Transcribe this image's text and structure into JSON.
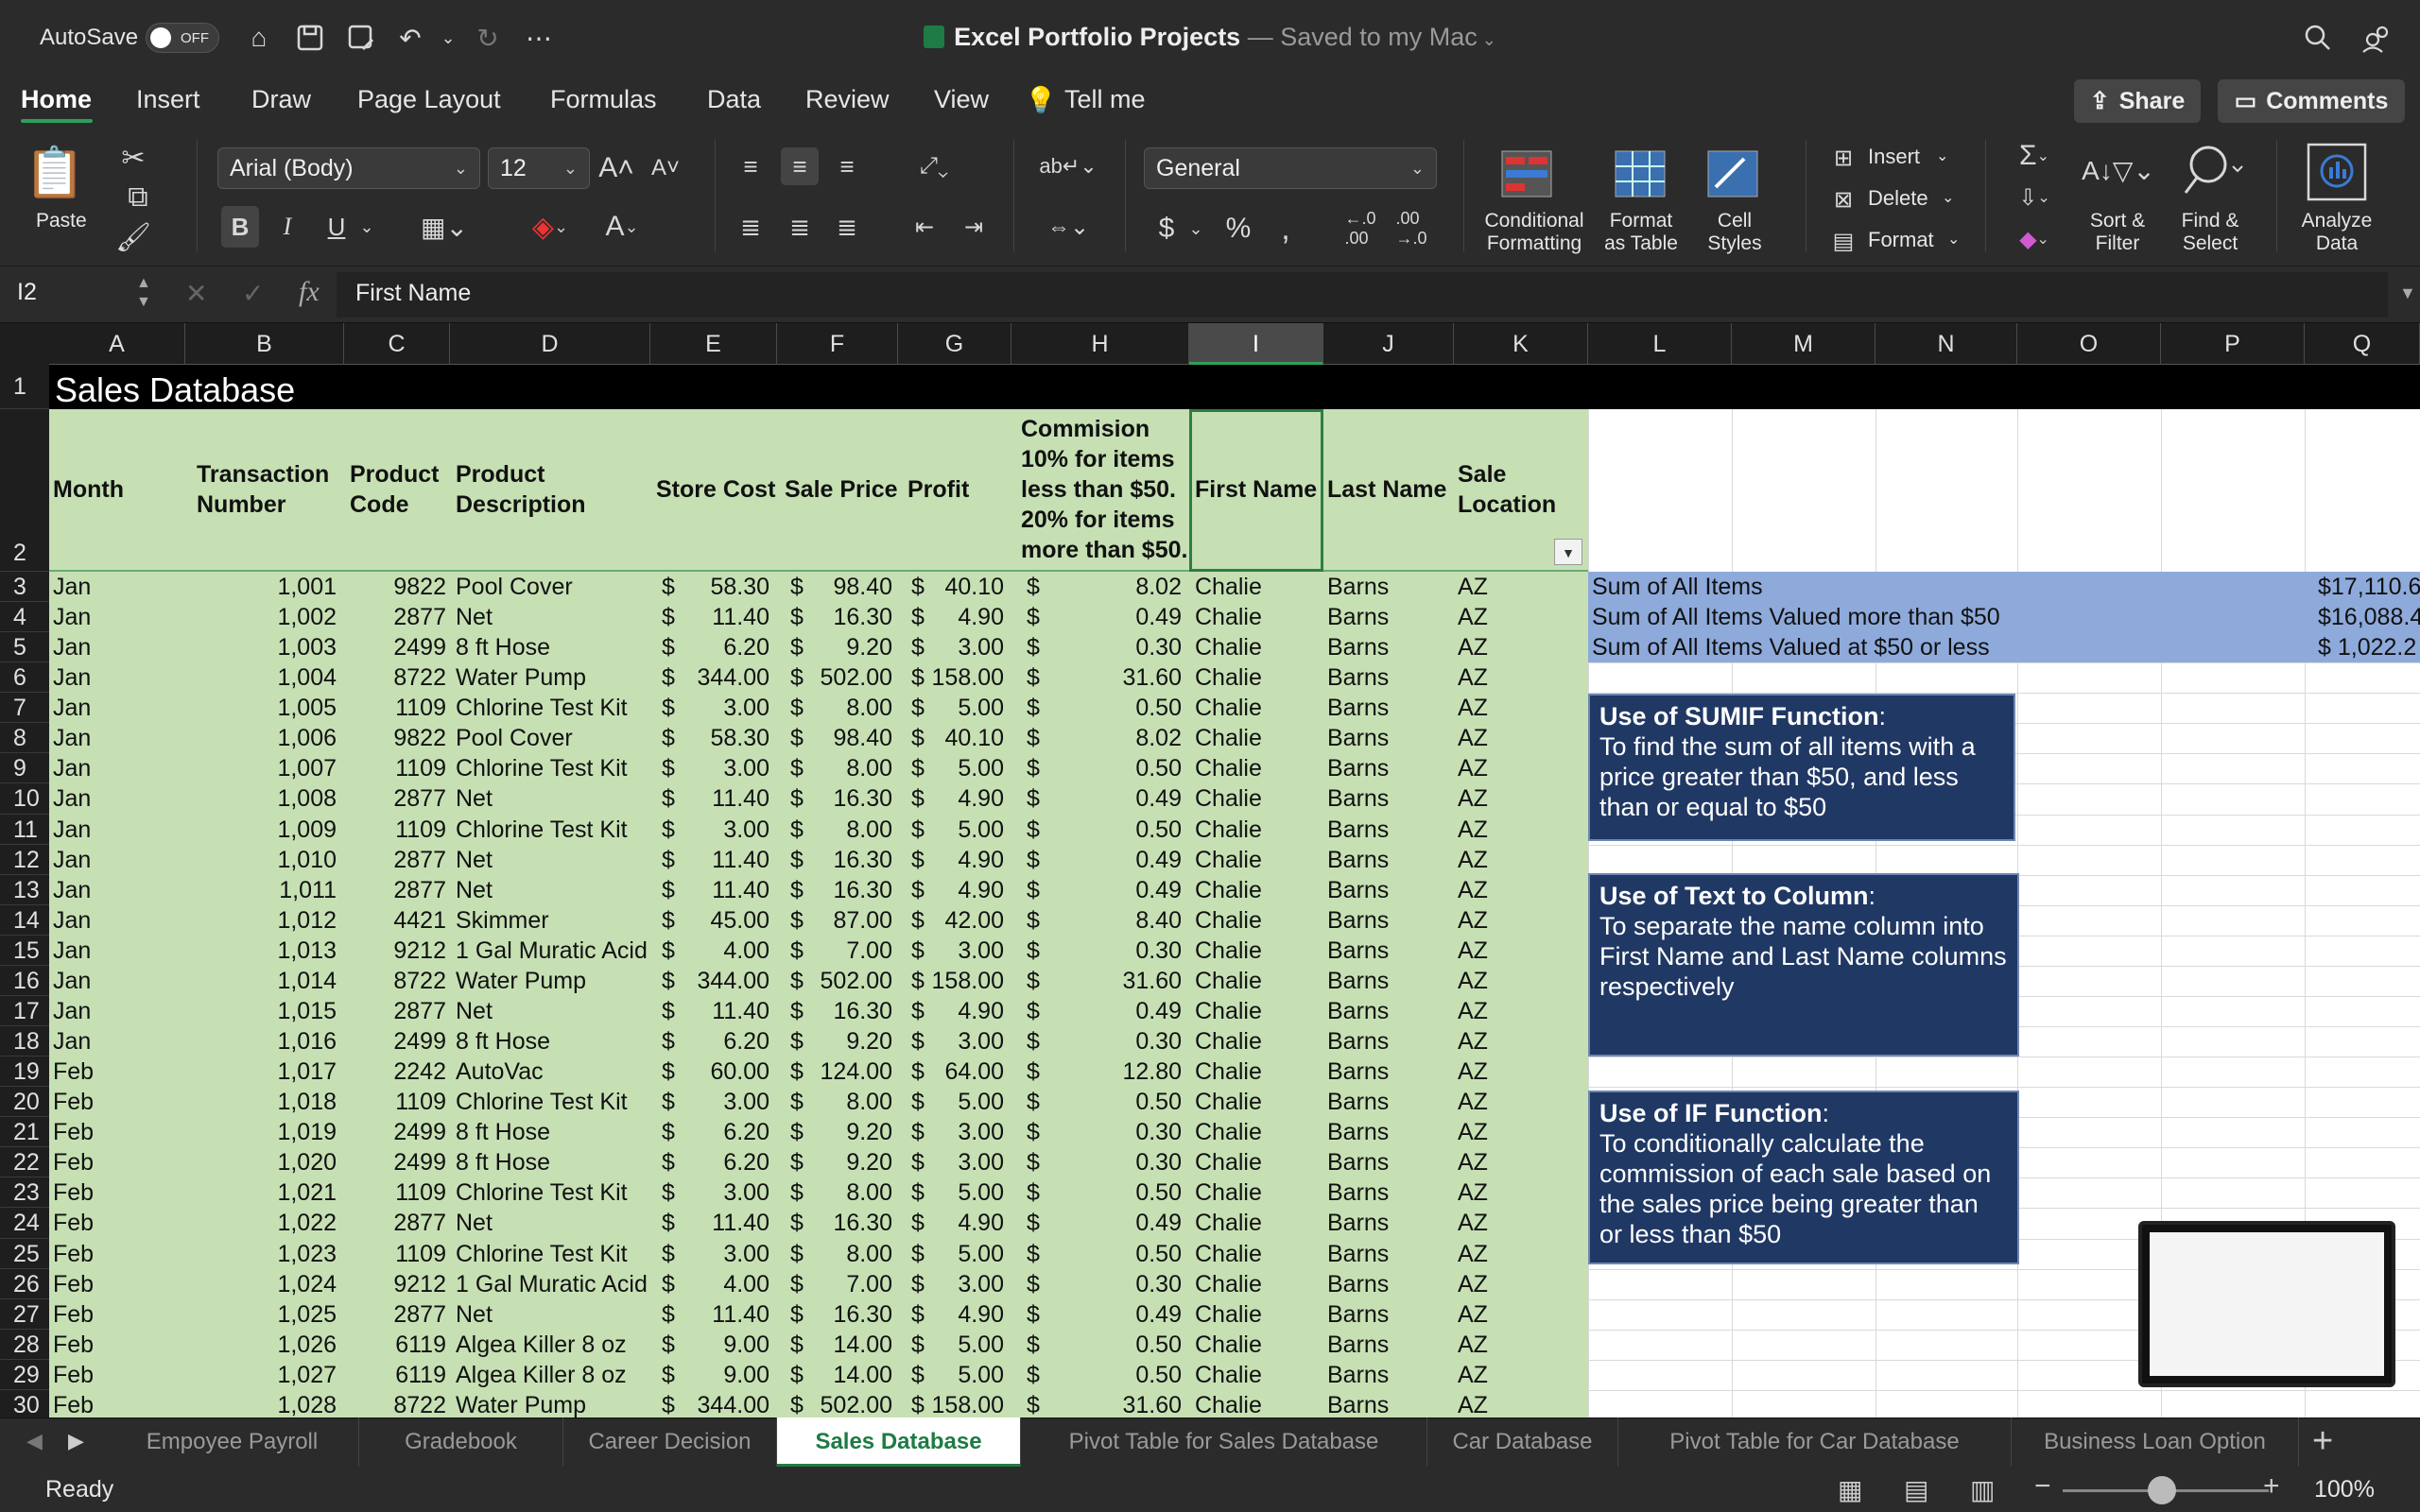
{
  "titlebar": {
    "autosave_label": "AutoSave",
    "autosave_state": "OFF",
    "doc_name": "Excel Portfolio Projects",
    "doc_status": " — Saved to my Mac",
    "icons": [
      "home-icon",
      "save-icon",
      "save-as-icon",
      "undo-icon",
      "redo-icon",
      "more-icon",
      "search-icon",
      "share-people-icon"
    ]
  },
  "menu": {
    "items": [
      "Home",
      "Insert",
      "Draw",
      "Page Layout",
      "Formulas",
      "Data",
      "Review",
      "View",
      "Tell me"
    ],
    "active": "Home",
    "share_label": "Share",
    "comments_label": "Comments"
  },
  "ribbon": {
    "paste_label": "Paste",
    "font_name": "Arial (Body)",
    "font_size": "12",
    "number_format": "General",
    "bold": "B",
    "italic": "I",
    "underline": "U",
    "currency": "$",
    "percent": "%",
    "conditional_formatting": [
      "Conditional",
      "Formatting"
    ],
    "format_as_table": [
      "Format",
      "as Table"
    ],
    "cell_styles": [
      "Cell",
      "Styles"
    ],
    "insert_label": "Insert",
    "delete_label": "Delete",
    "format_label": "Format",
    "sort_filter": [
      "Sort &",
      "Filter"
    ],
    "find_select": [
      "Find &",
      "Select"
    ],
    "analyze_data": [
      "Analyze",
      "Data"
    ]
  },
  "formula_bar": {
    "name_box": "I2",
    "fx": "fx",
    "value": "First Name"
  },
  "columns": [
    "A",
    "B",
    "C",
    "D",
    "E",
    "F",
    "G",
    "H",
    "I",
    "J",
    "K",
    "L",
    "M",
    "N",
    "O",
    "P",
    "Q"
  ],
  "selected_column": "I",
  "rows": [
    "1",
    "2",
    "3",
    "4",
    "5",
    "6",
    "7",
    "8",
    "9",
    "10",
    "11",
    "12",
    "13",
    "14",
    "15",
    "16",
    "17",
    "18",
    "19",
    "20",
    "21",
    "22",
    "23",
    "24",
    "25",
    "26",
    "27",
    "28",
    "29",
    "30"
  ],
  "sheet": {
    "title": "Sales Database",
    "headers": {
      "month": "Month",
      "transaction": [
        "Transaction",
        "Number"
      ],
      "product_code": [
        "Product",
        "Code"
      ],
      "product_desc": [
        "Product",
        "Description"
      ],
      "store_cost": "Store Cost",
      "sale_price": "Sale Price",
      "profit": "Profit",
      "commission": [
        "Commision",
        "10% for items",
        "less than $50.",
        "20% for items",
        "more than $50."
      ],
      "first_name": "First Name",
      "last_name": "Last Name",
      "sale_location": [
        "Sale",
        "Location"
      ]
    },
    "data": [
      [
        "Jan",
        "1,001",
        "9822",
        "Pool Cover",
        "58.30",
        "98.40",
        "40.10",
        "8.02",
        "Chalie",
        "Barns",
        "AZ"
      ],
      [
        "Jan",
        "1,002",
        "2877",
        "Net",
        "11.40",
        "16.30",
        "4.90",
        "0.49",
        "Chalie",
        "Barns",
        "AZ"
      ],
      [
        "Jan",
        "1,003",
        "2499",
        "8 ft Hose",
        "6.20",
        "9.20",
        "3.00",
        "0.30",
        "Chalie",
        "Barns",
        "AZ"
      ],
      [
        "Jan",
        "1,004",
        "8722",
        "Water Pump",
        "344.00",
        "502.00",
        "158.00",
        "31.60",
        "Chalie",
        "Barns",
        "AZ"
      ],
      [
        "Jan",
        "1,005",
        "1109",
        "Chlorine Test Kit",
        "3.00",
        "8.00",
        "5.00",
        "0.50",
        "Chalie",
        "Barns",
        "AZ"
      ],
      [
        "Jan",
        "1,006",
        "9822",
        "Pool Cover",
        "58.30",
        "98.40",
        "40.10",
        "8.02",
        "Chalie",
        "Barns",
        "AZ"
      ],
      [
        "Jan",
        "1,007",
        "1109",
        "Chlorine Test Kit",
        "3.00",
        "8.00",
        "5.00",
        "0.50",
        "Chalie",
        "Barns",
        "AZ"
      ],
      [
        "Jan",
        "1,008",
        "2877",
        "Net",
        "11.40",
        "16.30",
        "4.90",
        "0.49",
        "Chalie",
        "Barns",
        "AZ"
      ],
      [
        "Jan",
        "1,009",
        "1109",
        "Chlorine Test Kit",
        "3.00",
        "8.00",
        "5.00",
        "0.50",
        "Chalie",
        "Barns",
        "AZ"
      ],
      [
        "Jan",
        "1,010",
        "2877",
        "Net",
        "11.40",
        "16.30",
        "4.90",
        "0.49",
        "Chalie",
        "Barns",
        "AZ"
      ],
      [
        "Jan",
        "1,011",
        "2877",
        "Net",
        "11.40",
        "16.30",
        "4.90",
        "0.49",
        "Chalie",
        "Barns",
        "AZ"
      ],
      [
        "Jan",
        "1,012",
        "4421",
        "Skimmer",
        "45.00",
        "87.00",
        "42.00",
        "8.40",
        "Chalie",
        "Barns",
        "AZ"
      ],
      [
        "Jan",
        "1,013",
        "9212",
        "1 Gal Muratic Acid",
        "4.00",
        "7.00",
        "3.00",
        "0.30",
        "Chalie",
        "Barns",
        "AZ"
      ],
      [
        "Jan",
        "1,014",
        "8722",
        "Water Pump",
        "344.00",
        "502.00",
        "158.00",
        "31.60",
        "Chalie",
        "Barns",
        "AZ"
      ],
      [
        "Jan",
        "1,015",
        "2877",
        "Net",
        "11.40",
        "16.30",
        "4.90",
        "0.49",
        "Chalie",
        "Barns",
        "AZ"
      ],
      [
        "Jan",
        "1,016",
        "2499",
        "8 ft Hose",
        "6.20",
        "9.20",
        "3.00",
        "0.30",
        "Chalie",
        "Barns",
        "AZ"
      ],
      [
        "Feb",
        "1,017",
        "2242",
        "AutoVac",
        "60.00",
        "124.00",
        "64.00",
        "12.80",
        "Chalie",
        "Barns",
        "AZ"
      ],
      [
        "Feb",
        "1,018",
        "1109",
        "Chlorine Test Kit",
        "3.00",
        "8.00",
        "5.00",
        "0.50",
        "Chalie",
        "Barns",
        "AZ"
      ],
      [
        "Feb",
        "1,019",
        "2499",
        "8 ft Hose",
        "6.20",
        "9.20",
        "3.00",
        "0.30",
        "Chalie",
        "Barns",
        "AZ"
      ],
      [
        "Feb",
        "1,020",
        "2499",
        "8 ft Hose",
        "6.20",
        "9.20",
        "3.00",
        "0.30",
        "Chalie",
        "Barns",
        "AZ"
      ],
      [
        "Feb",
        "1,021",
        "1109",
        "Chlorine Test Kit",
        "3.00",
        "8.00",
        "5.00",
        "0.50",
        "Chalie",
        "Barns",
        "AZ"
      ],
      [
        "Feb",
        "1,022",
        "2877",
        "Net",
        "11.40",
        "16.30",
        "4.90",
        "0.49",
        "Chalie",
        "Barns",
        "AZ"
      ],
      [
        "Feb",
        "1,023",
        "1109",
        "Chlorine Test Kit",
        "3.00",
        "8.00",
        "5.00",
        "0.50",
        "Chalie",
        "Barns",
        "AZ"
      ],
      [
        "Feb",
        "1,024",
        "9212",
        "1 Gal Muratic Acid",
        "4.00",
        "7.00",
        "3.00",
        "0.30",
        "Chalie",
        "Barns",
        "AZ"
      ],
      [
        "Feb",
        "1,025",
        "2877",
        "Net",
        "11.40",
        "16.30",
        "4.90",
        "0.49",
        "Chalie",
        "Barns",
        "AZ"
      ],
      [
        "Feb",
        "1,026",
        "6119",
        "Algea Killer 8 oz",
        "9.00",
        "14.00",
        "5.00",
        "0.50",
        "Chalie",
        "Barns",
        "AZ"
      ],
      [
        "Feb",
        "1,027",
        "6119",
        "Algea Killer 8 oz",
        "9.00",
        "14.00",
        "5.00",
        "0.50",
        "Chalie",
        "Barns",
        "AZ"
      ],
      [
        "Feb",
        "1,028",
        "8722",
        "Water Pump",
        "344.00",
        "502.00",
        "158.00",
        "31.60",
        "Chalie",
        "Barns",
        "AZ"
      ]
    ],
    "dollar": "$"
  },
  "summary": [
    {
      "label": "Sum of All Items",
      "value": "$17,110.6"
    },
    {
      "label": "Sum of All Items Valued more than $50",
      "value": "$16,088.4"
    },
    {
      "label": "Sum of All Items Valued at $50 or less",
      "value": "$  1,022.2"
    }
  ],
  "notes": [
    {
      "title": "Use of SUMIF Function",
      "body": "To find the sum of all items with a price greater than $50, and less than or equal to $50"
    },
    {
      "title": "Use of Text to Column",
      "body": "To separate the name column into First Name and Last Name columns respectively"
    },
    {
      "title": "Use of IF Function",
      "body": "To conditionally calculate the commission of each sale based on the sales price being greater than or less than $50"
    }
  ],
  "tabs": [
    "Empoyee Payroll",
    "Gradebook",
    "Career Decision",
    "Sales Database",
    "Pivot Table for Sales Database",
    "Car Database",
    "Pivot Table for Car Database",
    "Business Loan Option"
  ],
  "active_tab": "Sales Database",
  "status": {
    "text": "Ready",
    "zoom": "100%"
  },
  "colors": {
    "table_green": "#c6e0b4",
    "summary_blue": "#8eaadb",
    "note_navy": "#203864",
    "excel_green": "#1e7b45"
  }
}
